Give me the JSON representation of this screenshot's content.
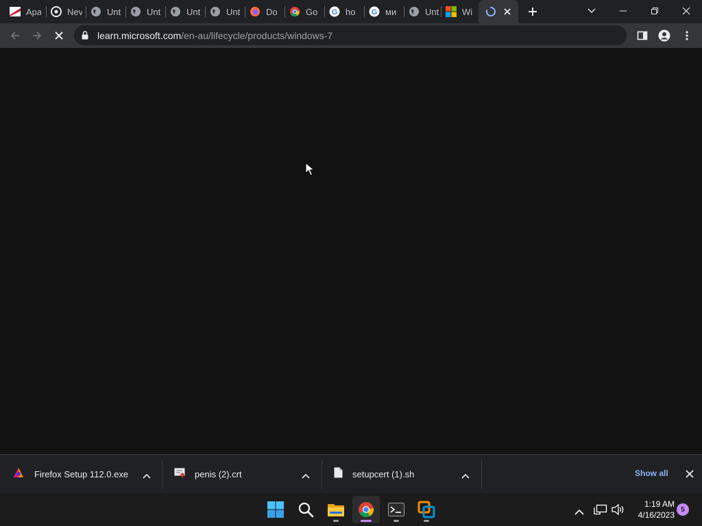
{
  "browser": {
    "tabs": [
      {
        "title": "Apa",
        "icon": "red-stripe-icon"
      },
      {
        "title": "Nev",
        "icon": "chromium-icon"
      },
      {
        "title": "Unt",
        "icon": "globe-icon"
      },
      {
        "title": "Unt",
        "icon": "globe-icon"
      },
      {
        "title": "Unt",
        "icon": "globe-icon"
      },
      {
        "title": "Unt",
        "icon": "globe-icon"
      },
      {
        "title": "Do",
        "icon": "firefox-icon"
      },
      {
        "title": "Go",
        "icon": "chrome-icon"
      },
      {
        "title": "ho",
        "icon": "google-icon"
      },
      {
        "title": "ми",
        "icon": "google-icon"
      },
      {
        "title": "Unt",
        "icon": "globe-icon"
      },
      {
        "title": "Wi",
        "icon": "windows-logo-icon"
      }
    ],
    "url_host": "learn.microsoft.com",
    "url_path": "/en-au/lifecycle/products/windows-7"
  },
  "downloads": {
    "items": [
      {
        "name": "Firefox Setup 112.0.exe",
        "icon": "firefox-installer-icon"
      },
      {
        "name": "penis (2).crt",
        "icon": "certificate-icon"
      },
      {
        "name": "setupcert (1).sh",
        "icon": "document-icon"
      }
    ],
    "show_all": "Show all"
  },
  "taskbar": {
    "time": "1:19 AM",
    "date": "4/16/2023",
    "notification_count": "5"
  },
  "colors": {
    "tab_bar": "#202124",
    "toolbar": "#35363a",
    "page": "#121212",
    "accent_link": "#8ab4f8",
    "chrome_indicator": "#c58af9"
  }
}
